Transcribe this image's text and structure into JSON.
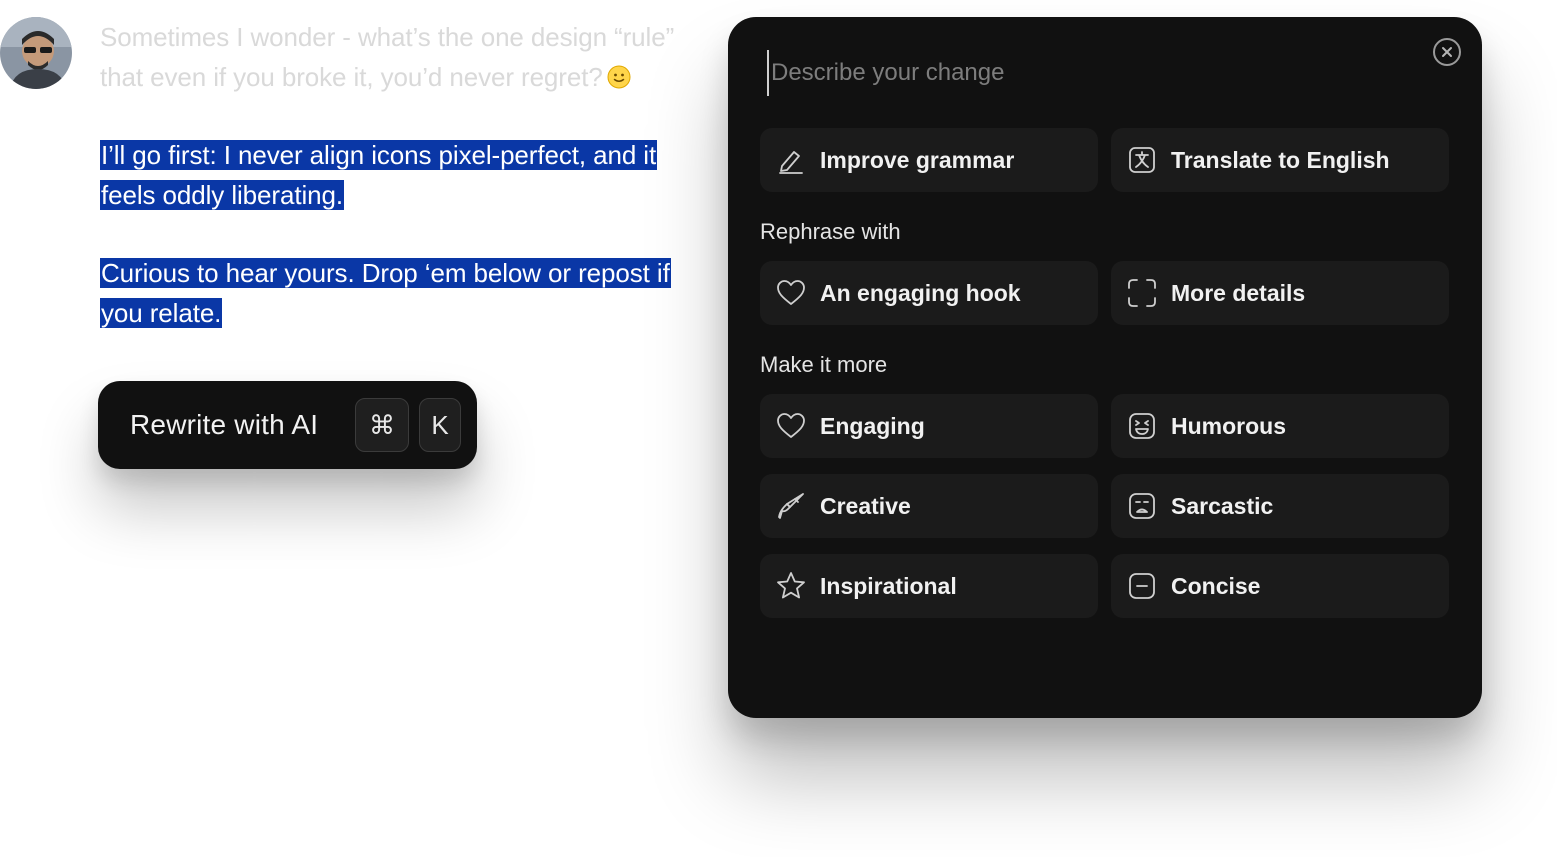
{
  "post": {
    "intro": "Sometimes I wonder - what’s the one design “rule” that even if you broke it, you’d never regret?",
    "line1": "I’ll go first: I never align icons pixel-perfect, and it feels oddly liberating.",
    "line2": "Curious to hear yours. Drop ‘em below or repost if you relate."
  },
  "rewrite_pill": {
    "label": "Rewrite with AI",
    "cmd_key": "⌘",
    "k_key": "K"
  },
  "panel": {
    "input_placeholder": "Describe your change",
    "quick_actions": [
      {
        "label": "Improve grammar",
        "icon": "pencil-icon"
      },
      {
        "label": "Translate to English",
        "icon": "translate-icon"
      }
    ],
    "rephrase_heading": "Rephrase with",
    "rephrase": [
      {
        "label": "An engaging hook",
        "icon": "heart-icon"
      },
      {
        "label": "More details",
        "icon": "expand-icon"
      }
    ],
    "more_heading": "Make it more",
    "tones": [
      {
        "label": "Engaging",
        "icon": "heart-icon"
      },
      {
        "label": "Humorous",
        "icon": "laughing-face-icon"
      },
      {
        "label": "Creative",
        "icon": "brush-icon"
      },
      {
        "label": "Sarcastic",
        "icon": "sarcastic-face-icon"
      },
      {
        "label": "Inspirational",
        "icon": "star-icon"
      },
      {
        "label": "Concise",
        "icon": "minus-box-icon"
      }
    ]
  }
}
